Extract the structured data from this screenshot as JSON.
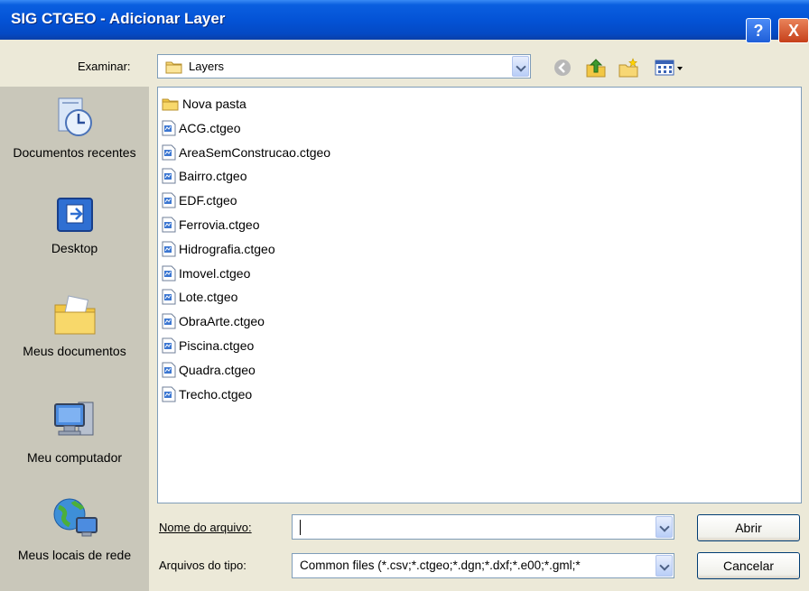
{
  "window": {
    "title": "SIG CTGEO - Adicionar Layer",
    "help_glyph": "?",
    "close_glyph": "X"
  },
  "lookin": {
    "label": "Examinar:",
    "value": "Layers"
  },
  "places": [
    {
      "label": "Documentos recentes",
      "icon": "recent-documents-icon"
    },
    {
      "label": "Desktop",
      "icon": "desktop-icon"
    },
    {
      "label": "Meus documentos",
      "icon": "my-documents-icon"
    },
    {
      "label": "Meu computador",
      "icon": "my-computer-icon"
    },
    {
      "label": "Meus locais de rede",
      "icon": "network-places-icon"
    }
  ],
  "files": [
    {
      "name": "Nova pasta",
      "type": "folder"
    },
    {
      "name": "ACG.ctgeo",
      "type": "file"
    },
    {
      "name": "AreaSemConstrucao.ctgeo",
      "type": "file"
    },
    {
      "name": "Bairro.ctgeo",
      "type": "file"
    },
    {
      "name": "EDF.ctgeo",
      "type": "file"
    },
    {
      "name": "Ferrovia.ctgeo",
      "type": "file"
    },
    {
      "name": "Hidrografia.ctgeo",
      "type": "file"
    },
    {
      "name": "Imovel.ctgeo",
      "type": "file"
    },
    {
      "name": "Lote.ctgeo",
      "type": "file"
    },
    {
      "name": "ObraArte.ctgeo",
      "type": "file"
    },
    {
      "name": "Piscina.ctgeo",
      "type": "file"
    },
    {
      "name": "Quadra.ctgeo",
      "type": "file"
    },
    {
      "name": "Trecho.ctgeo",
      "type": "file"
    }
  ],
  "filename": {
    "label": "Nome do arquivo:",
    "value": ""
  },
  "filetype": {
    "label": "Arquivos do tipo:",
    "value": "Common files (*.csv;*.ctgeo;*.dgn;*.dxf;*.e00;*.gml;*"
  },
  "buttons": {
    "open": "Abrir",
    "cancel": "Cancelar"
  },
  "colors": {
    "titlebar": "#0453D6",
    "dialog_bg": "#ECE9D8",
    "sidebar_bg": "#C9C7BA"
  }
}
